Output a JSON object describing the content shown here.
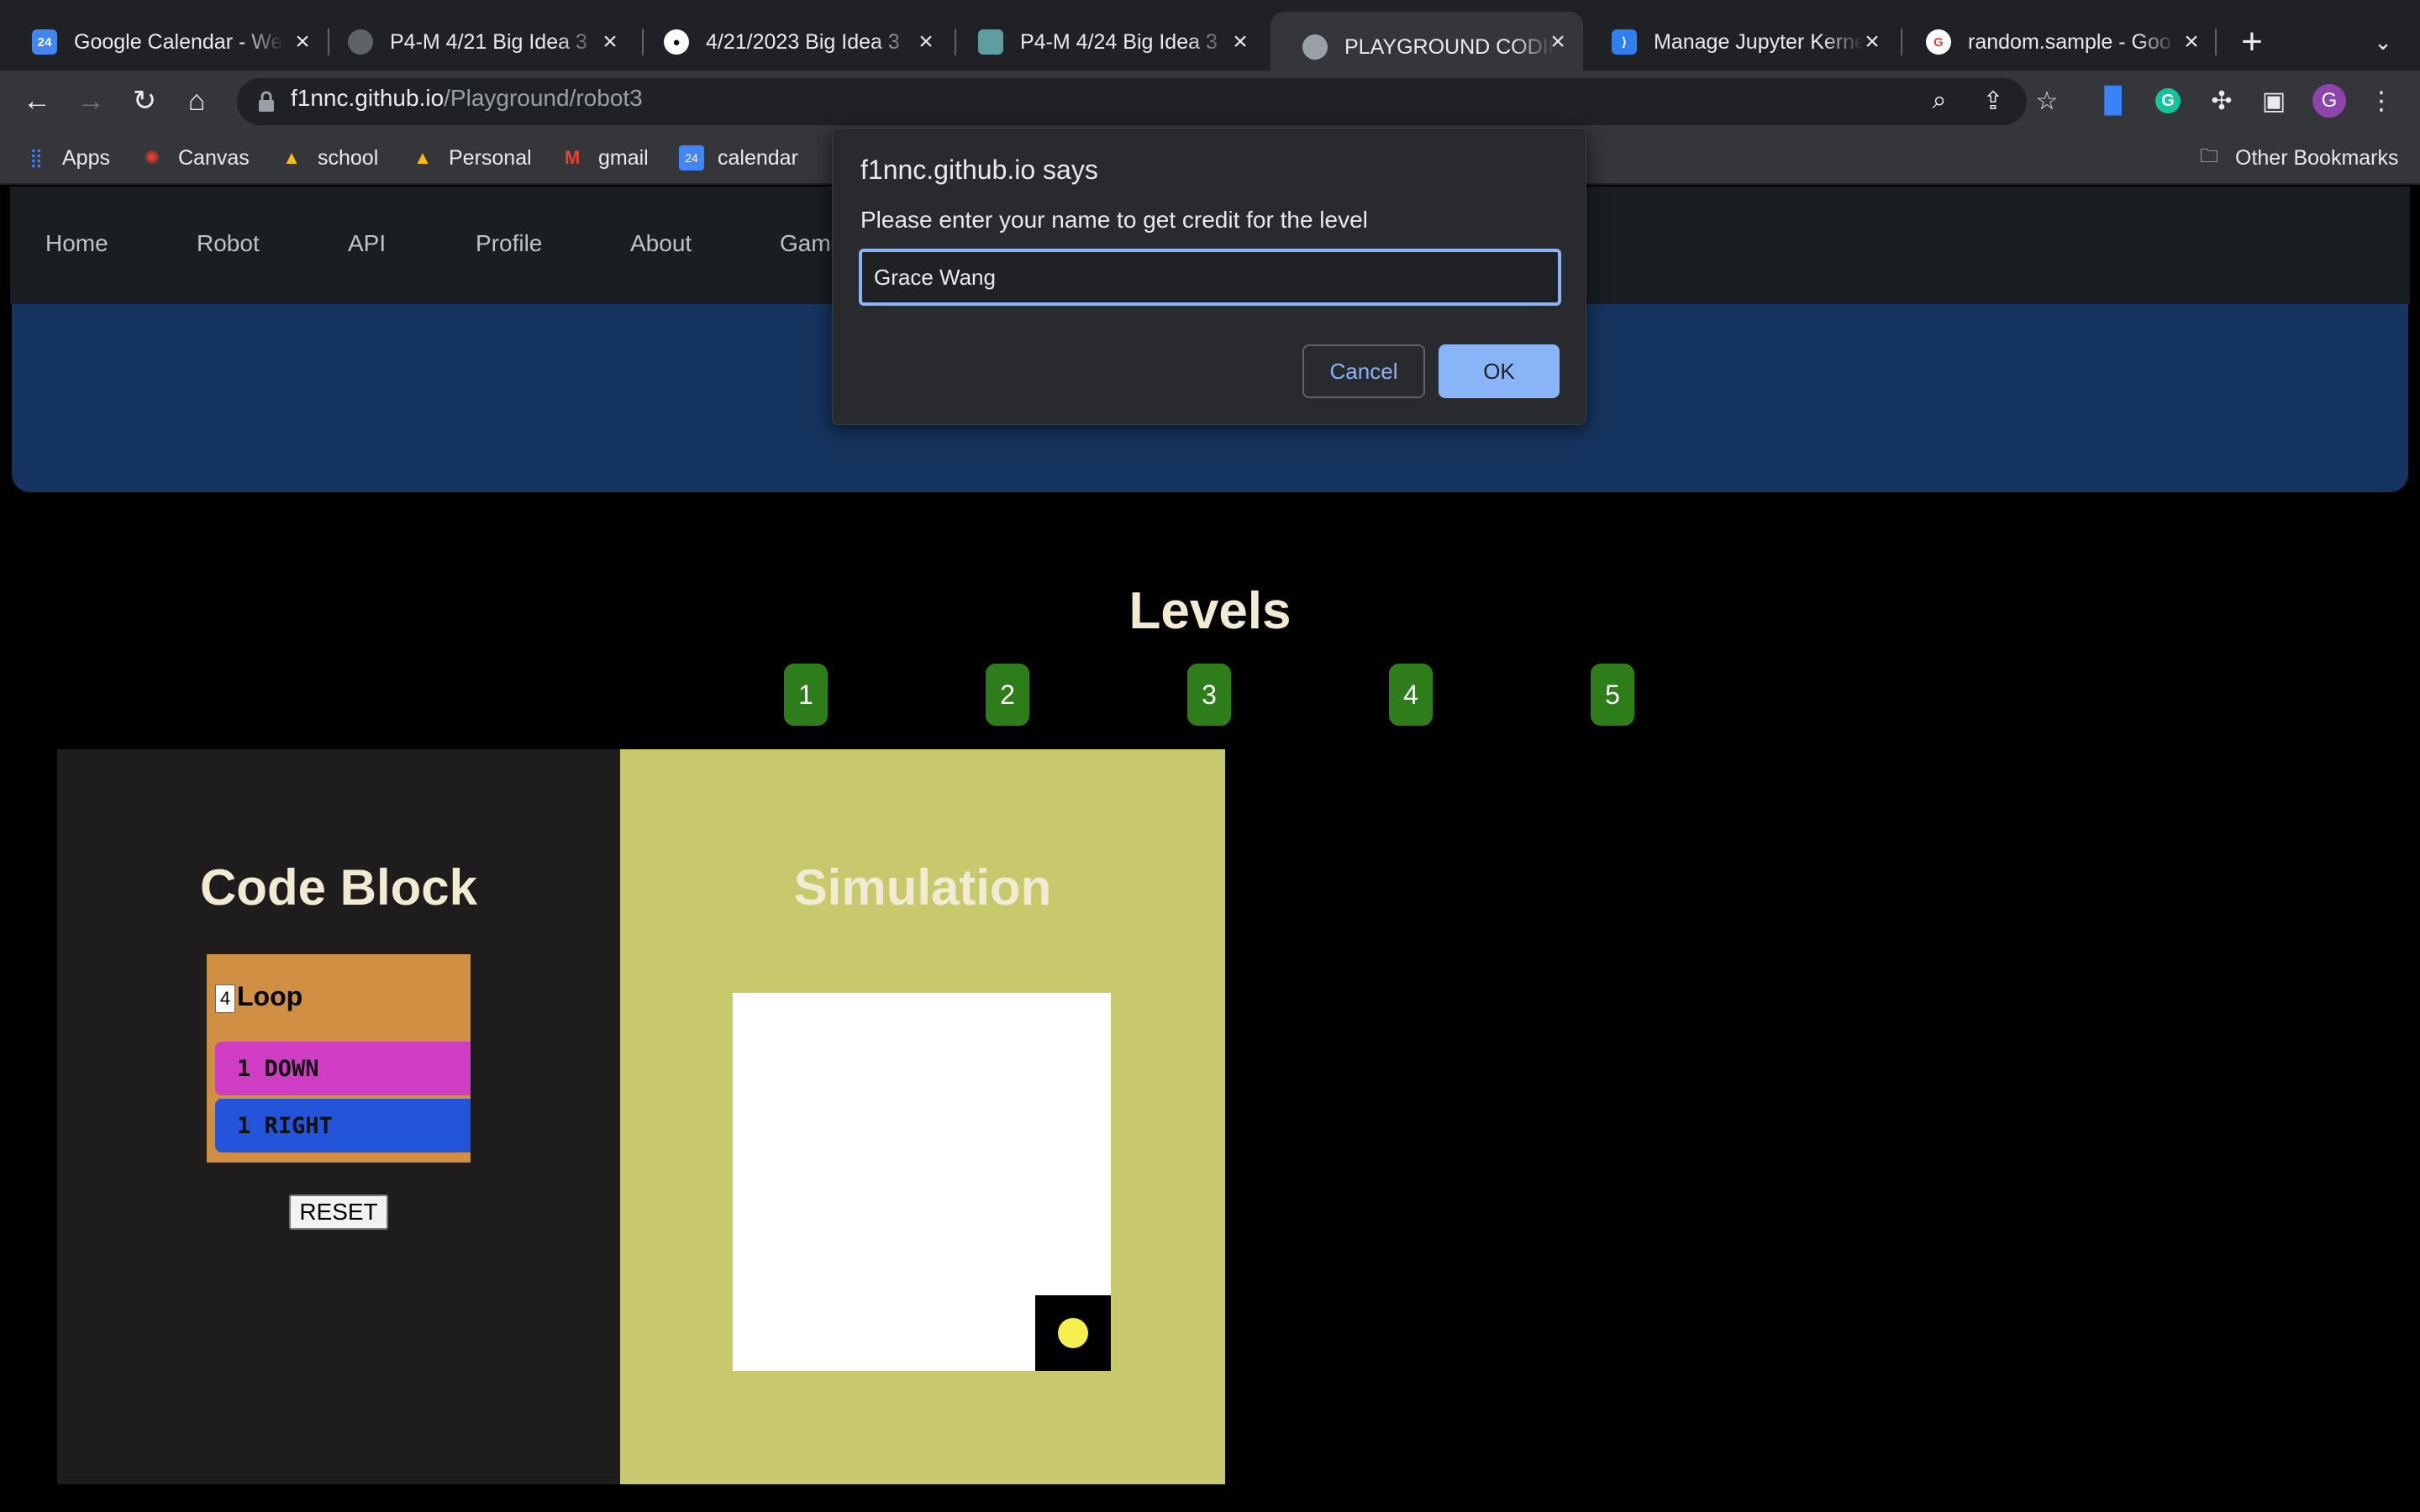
{
  "browser": {
    "tabs": [
      {
        "title": "Google Calendar - We",
        "icon": "calendar-icon",
        "color": "#4285f4"
      },
      {
        "title": "P4-M 4/21 Big Idea 3",
        "icon": "globe-search-icon",
        "color": "#9aa0a6"
      },
      {
        "title": "4/21/2023 Big Idea 3",
        "icon": "github-icon",
        "color": "#ffffff"
      },
      {
        "title": "P4-M 4/24 Big Idea 3",
        "icon": "fastpages-icon",
        "color": "#5f9ea0"
      },
      {
        "title": "PLAYGROUND CODIN",
        "icon": "globe-icon",
        "color": "#9aa0a6",
        "active": true
      },
      {
        "title": "Manage Jupyter Kerne",
        "icon": "vscode-icon",
        "color": "#2f80ed"
      },
      {
        "title": "random.sample - Goo",
        "icon": "google-icon",
        "color": "#ea4335"
      }
    ],
    "url_host": "f1nnc.github.io",
    "url_path": "/Playground/robot3",
    "profile_initial": "G",
    "bookmarks": [
      {
        "label": "Apps",
        "icon": "apps-grid-icon"
      },
      {
        "label": "Canvas",
        "icon": "canvas-icon"
      },
      {
        "label": "school",
        "icon": "drive-icon"
      },
      {
        "label": "Personal",
        "icon": "drive-icon"
      },
      {
        "label": "gmail",
        "icon": "gmail-icon"
      },
      {
        "label": "calendar",
        "icon": "calendar-icon"
      }
    ],
    "other_bookmarks": "Other Bookmarks"
  },
  "site": {
    "nav": [
      "Home",
      "Robot",
      "API",
      "Profile",
      "About",
      "Game"
    ],
    "levels_title": "Levels",
    "levels": [
      "1",
      "2",
      "3",
      "4",
      "5"
    ],
    "code_block": {
      "title": "Code Block",
      "loop_count": "4",
      "loop_label": "Loop",
      "commands": [
        "1 DOWN",
        "1 RIGHT"
      ],
      "reset_label": "RESET"
    },
    "simulation": {
      "title": "Simulation"
    }
  },
  "dialog": {
    "title": "f1nnc.github.io says",
    "message": "Please enter your name to get credit for the level",
    "input_value": "Grace Wang",
    "cancel_label": "Cancel",
    "ok_label": "OK"
  },
  "colors": {
    "accent": "#8ab4f8",
    "level_button": "#2e7d1b",
    "loop_block": "#d18f43",
    "down_block": "#cf3dc3",
    "right_block": "#2454d9",
    "simulation_bg": "#c8c86c",
    "robot": "#f6ef4e"
  }
}
